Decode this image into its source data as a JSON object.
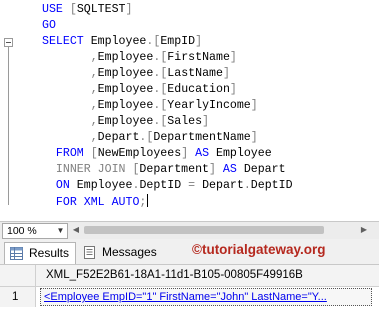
{
  "editor": {
    "lines": [
      {
        "parts": [
          {
            "t": "USE ",
            "c": "kw"
          },
          {
            "t": "[",
            "c": "punct"
          },
          {
            "t": "SQLTEST",
            "c": "ident"
          },
          {
            "t": "]",
            "c": "punct"
          }
        ]
      },
      {
        "parts": [
          {
            "t": "GO",
            "c": "kw"
          }
        ]
      },
      {
        "parts": [
          {
            "t": "SELECT ",
            "c": "kw"
          },
          {
            "t": "Employee",
            "c": "ident"
          },
          {
            "t": ".",
            "c": "punct"
          },
          {
            "t": "[",
            "c": "punct"
          },
          {
            "t": "EmpID",
            "c": "ident"
          },
          {
            "t": "]",
            "c": "punct"
          }
        ]
      },
      {
        "parts": [
          {
            "t": "       ",
            "c": "ident"
          },
          {
            "t": ",",
            "c": "comma"
          },
          {
            "t": "Employee",
            "c": "ident"
          },
          {
            "t": ".",
            "c": "punct"
          },
          {
            "t": "[",
            "c": "punct"
          },
          {
            "t": "FirstName",
            "c": "ident"
          },
          {
            "t": "]",
            "c": "punct"
          }
        ]
      },
      {
        "parts": [
          {
            "t": "       ",
            "c": "ident"
          },
          {
            "t": ",",
            "c": "comma"
          },
          {
            "t": "Employee",
            "c": "ident"
          },
          {
            "t": ".",
            "c": "punct"
          },
          {
            "t": "[",
            "c": "punct"
          },
          {
            "t": "LastName",
            "c": "ident"
          },
          {
            "t": "]",
            "c": "punct"
          }
        ]
      },
      {
        "parts": [
          {
            "t": "       ",
            "c": "ident"
          },
          {
            "t": ",",
            "c": "comma"
          },
          {
            "t": "Employee",
            "c": "ident"
          },
          {
            "t": ".",
            "c": "punct"
          },
          {
            "t": "[",
            "c": "punct"
          },
          {
            "t": "Education",
            "c": "ident"
          },
          {
            "t": "]",
            "c": "punct"
          }
        ]
      },
      {
        "parts": [
          {
            "t": "       ",
            "c": "ident"
          },
          {
            "t": ",",
            "c": "comma"
          },
          {
            "t": "Employee",
            "c": "ident"
          },
          {
            "t": ".",
            "c": "punct"
          },
          {
            "t": "[",
            "c": "punct"
          },
          {
            "t": "YearlyIncome",
            "c": "ident"
          },
          {
            "t": "]",
            "c": "punct"
          }
        ]
      },
      {
        "parts": [
          {
            "t": "       ",
            "c": "ident"
          },
          {
            "t": ",",
            "c": "comma"
          },
          {
            "t": "Employee",
            "c": "ident"
          },
          {
            "t": ".",
            "c": "punct"
          },
          {
            "t": "[",
            "c": "punct"
          },
          {
            "t": "Sales",
            "c": "ident"
          },
          {
            "t": "]",
            "c": "punct"
          }
        ]
      },
      {
        "parts": [
          {
            "t": "       ",
            "c": "ident"
          },
          {
            "t": ",",
            "c": "comma"
          },
          {
            "t": "Depart",
            "c": "ident"
          },
          {
            "t": ".",
            "c": "punct"
          },
          {
            "t": "[",
            "c": "punct"
          },
          {
            "t": "DepartmentName",
            "c": "ident"
          },
          {
            "t": "]",
            "c": "punct"
          }
        ]
      },
      {
        "parts": [
          {
            "t": "  ",
            "c": "ident"
          },
          {
            "t": "FROM ",
            "c": "kw"
          },
          {
            "t": "[",
            "c": "punct"
          },
          {
            "t": "NewEmployees",
            "c": "ident"
          },
          {
            "t": "]",
            "c": "punct"
          },
          {
            "t": " AS ",
            "c": "kw"
          },
          {
            "t": "Employee",
            "c": "ident"
          }
        ]
      },
      {
        "parts": [
          {
            "t": "  ",
            "c": "ident"
          },
          {
            "t": "INNER JOIN ",
            "c": "kw-gray"
          },
          {
            "t": "[",
            "c": "punct"
          },
          {
            "t": "Department",
            "c": "ident"
          },
          {
            "t": "]",
            "c": "punct"
          },
          {
            "t": " AS ",
            "c": "kw"
          },
          {
            "t": "Depart",
            "c": "ident"
          }
        ]
      },
      {
        "parts": [
          {
            "t": "  ",
            "c": "ident"
          },
          {
            "t": "ON ",
            "c": "kw"
          },
          {
            "t": "Employee",
            "c": "ident"
          },
          {
            "t": ".",
            "c": "punct"
          },
          {
            "t": "DeptID ",
            "c": "ident"
          },
          {
            "t": "=",
            "c": "punct"
          },
          {
            "t": " Depart",
            "c": "ident"
          },
          {
            "t": ".",
            "c": "punct"
          },
          {
            "t": "DeptID",
            "c": "ident"
          }
        ]
      },
      {
        "parts": [
          {
            "t": "  ",
            "c": "ident"
          },
          {
            "t": "FOR XML AUTO",
            "c": "kw"
          },
          {
            "t": ";",
            "c": "punct"
          }
        ]
      }
    ]
  },
  "zoom": {
    "value": "100 %"
  },
  "tabs": {
    "results": "Results",
    "messages": "Messages"
  },
  "watermark": "©tutorialgateway.org",
  "grid": {
    "column_header": "XML_F52E2B61-18A1-11d1-B105-00805F49916B",
    "rows": [
      {
        "num": "1",
        "value": "<Employee EmpID=\"1\" FirstName=\"John\" LastName=\"Y..."
      }
    ]
  },
  "colors": {
    "keyword": "#0000ff",
    "gray_keyword": "#808080",
    "watermark": "#b5281e",
    "link": "#0000ee"
  }
}
